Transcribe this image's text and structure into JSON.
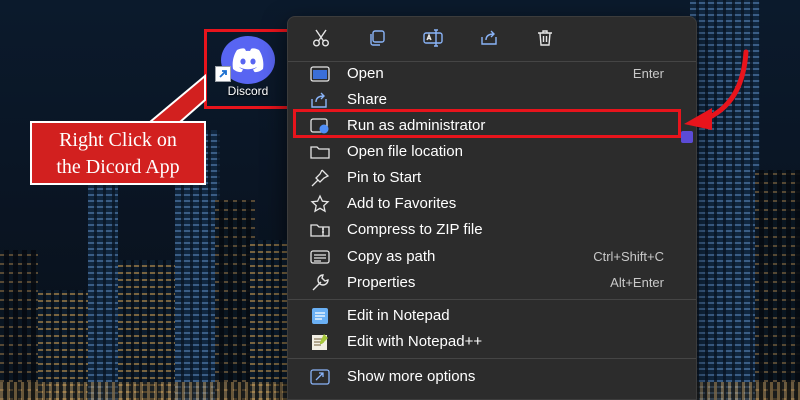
{
  "desktop": {
    "icon_label": "Discord",
    "icon": "discord-icon"
  },
  "callout": {
    "line1": "Right Click on",
    "line2": "the Dicord App"
  },
  "quick_actions": [
    {
      "name": "cut",
      "icon": "scissors-icon"
    },
    {
      "name": "copy",
      "icon": "copy-icon"
    },
    {
      "name": "rename",
      "icon": "rename-icon"
    },
    {
      "name": "share",
      "icon": "share-icon"
    },
    {
      "name": "delete",
      "icon": "trash-icon"
    }
  ],
  "menu_items": [
    {
      "label": "Open",
      "shortcut": "Enter",
      "icon": "open-app-icon"
    },
    {
      "label": "Share",
      "shortcut": "",
      "icon": "share-icon"
    },
    {
      "label": "Run as administrator",
      "shortcut": "",
      "icon": "shield-admin-icon"
    },
    {
      "label": "Open file location",
      "shortcut": "",
      "icon": "folder-icon"
    },
    {
      "label": "Pin to Start",
      "shortcut": "",
      "icon": "pin-icon"
    },
    {
      "label": "Add to Favorites",
      "shortcut": "",
      "icon": "star-icon"
    },
    {
      "label": "Compress to ZIP file",
      "shortcut": "",
      "icon": "zip-folder-icon"
    },
    {
      "label": "Copy as path",
      "shortcut": "Ctrl+Shift+C",
      "icon": "copy-path-icon"
    },
    {
      "label": "Properties",
      "shortcut": "Alt+Enter",
      "icon": "wrench-icon"
    },
    {
      "label": "Edit in Notepad",
      "shortcut": "",
      "icon": "notepad-icon"
    },
    {
      "label": "Edit with Notepad++",
      "shortcut": "",
      "icon": "notepadpp-icon"
    },
    {
      "label": "Show more options",
      "shortcut": "",
      "icon": "more-options-icon"
    }
  ],
  "colors": {
    "annotation_red": "#e8141c",
    "menu_bg": "#2c2c2c",
    "discord_blurple": "#5865f2"
  }
}
